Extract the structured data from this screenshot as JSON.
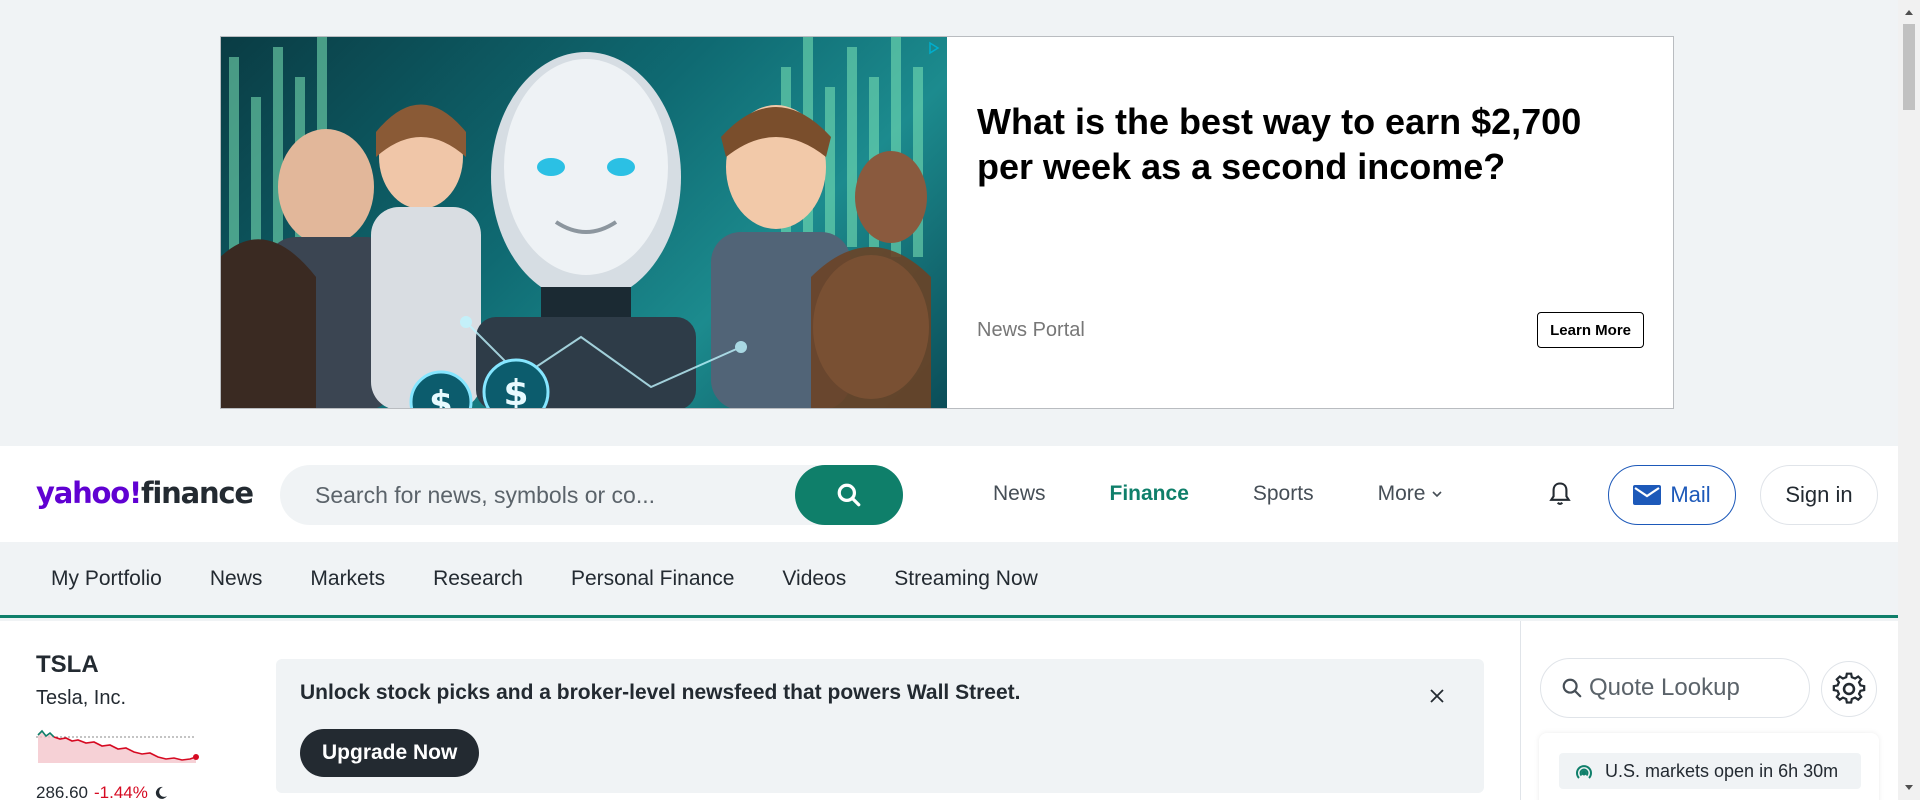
{
  "ad": {
    "headline": "What is the best way to earn $2,700 per week as a second income?",
    "sponsor": "News Portal",
    "cta_label": "Learn More",
    "image_icon": "robot-and-people-illustration"
  },
  "header": {
    "logo_yahoo": "yahoo!",
    "logo_finance": "finance",
    "search_placeholder": "Search for news, symbols or co...",
    "nav": [
      {
        "label": "News"
      },
      {
        "label": "Finance"
      },
      {
        "label": "Sports"
      },
      {
        "label": "More"
      }
    ],
    "mail_label": "Mail",
    "signin_label": "Sign in"
  },
  "subnav": {
    "items": [
      {
        "label": "My Portfolio"
      },
      {
        "label": "News"
      },
      {
        "label": "Markets"
      },
      {
        "label": "Research"
      },
      {
        "label": "Personal Finance"
      },
      {
        "label": "Videos"
      },
      {
        "label": "Streaming Now"
      }
    ]
  },
  "ticker": {
    "symbol": "TSLA",
    "name": "Tesla, Inc.",
    "price": "286.60",
    "change": "-1.44%"
  },
  "promo": {
    "text": "Unlock stock picks and a broker-level newsfeed that powers Wall Street.",
    "button_label": "Upgrade Now"
  },
  "right_rail": {
    "quote_placeholder": "Quote Lookup",
    "market_status": "U.S. markets open in 6h 30m"
  },
  "colors": {
    "brand_purple": "#6001d2",
    "accent_green": "#0f7f6a",
    "mail_blue": "#1d59b9",
    "negative_red": "#d60a22"
  }
}
